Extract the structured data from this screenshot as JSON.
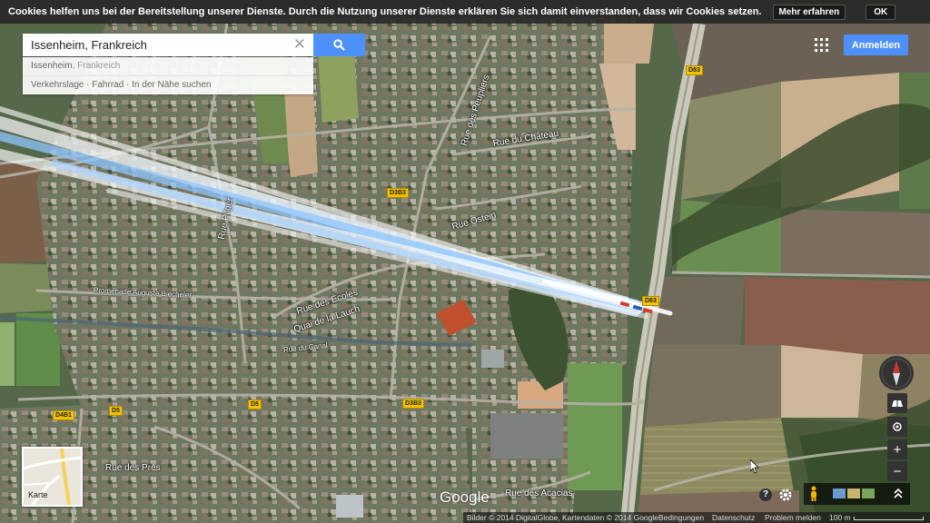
{
  "cookie_bar": {
    "text": "Cookies helfen uns bei der Bereitstellung unserer Dienste. Durch die Nutzung unserer Dienste erklären Sie sich damit einverstanden, dass wir Cookies setzen.",
    "more_label": "Mehr erfahren",
    "ok_label": "OK"
  },
  "search": {
    "query": "Issenheim, Frankreich",
    "suggestion_place": "Issenheim",
    "suggestion_region": ", Frankreich",
    "suggestion_links": "Verkehrslage · Fahrrad · In der Nähe suchen"
  },
  "header": {
    "signin_label": "Anmelden"
  },
  "minimap": {
    "label": "Karte"
  },
  "logo": {
    "text": "Google"
  },
  "road_labels": {
    "rue_des_peupliers": "Rue des Peupliers",
    "rue_du_chateau": "Rue du Château",
    "rue_ostein": "Rue Ostein",
    "rue_pilger": "Rue Pilger",
    "promenade": "Promenade Auguste Biecheler",
    "rue_des_ecoles": "Rue des Écoles",
    "quai_de_la_lauch": "Quai de la Lauch",
    "rue_du_canal": "Rue du Canal",
    "rue_des_pres": "Rue des Prés",
    "rue_des_acacias": "Rue des Acacias"
  },
  "route_shields": {
    "d83_top": "D83",
    "d383_upper": "D3B3",
    "d83_mid": "D83",
    "d481": "D4B1",
    "d5_left": "D5",
    "d5_mid": "D5",
    "d383_lower": "D3B3"
  },
  "footer": {
    "imagery": "Bilder © 2014 DigitalGlobe, Kartendaten © 2014 Google",
    "terms": "Bedingungen",
    "privacy": "Datenschutz",
    "report": "Problem melden",
    "scale": "100 m"
  },
  "colors": {
    "accent": "#4d90fe",
    "cookie_bg": "#282828",
    "route_shield": "#f2c200",
    "compass_north": "#d0342c"
  },
  "icons": [
    "search-icon",
    "close-icon",
    "apps-grid-icon",
    "compass-icon",
    "tilt-icon",
    "locate-icon",
    "zoom-in-icon",
    "zoom-out-icon",
    "help-icon",
    "gear-icon",
    "pegman-icon",
    "chevron-up-icon",
    "cursor-icon"
  ]
}
